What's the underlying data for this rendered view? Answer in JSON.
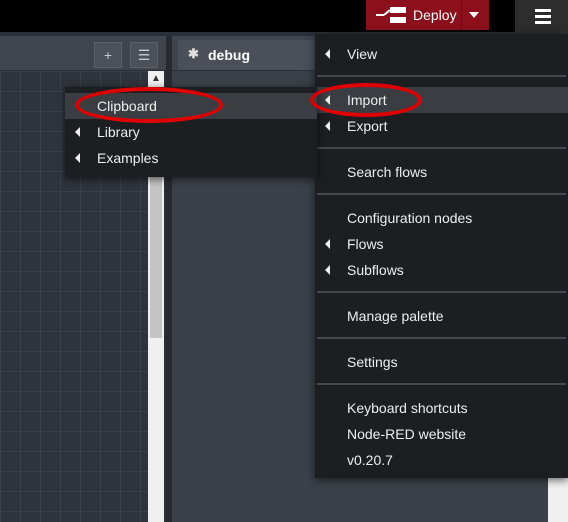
{
  "topbar": {
    "deploy_label": "Deploy"
  },
  "workspace": {
    "add_button": "+",
    "list_button": "☰"
  },
  "sidebar": {
    "debug_tab_label": "debug",
    "debug_icon": "✱"
  },
  "main_menu": {
    "items": [
      {
        "label": "View"
      },
      {
        "label": "Import"
      },
      {
        "label": "Export"
      },
      {
        "label": "Search flows"
      },
      {
        "label": "Configuration nodes"
      },
      {
        "label": "Flows"
      },
      {
        "label": "Subflows"
      },
      {
        "label": "Manage palette"
      },
      {
        "label": "Settings"
      },
      {
        "label": "Keyboard shortcuts"
      },
      {
        "label": "Node-RED website"
      },
      {
        "label": "v0.20.7"
      }
    ]
  },
  "import_submenu": {
    "items": [
      {
        "label": "Clipboard"
      },
      {
        "label": "Library"
      },
      {
        "label": "Examples"
      }
    ]
  },
  "colors": {
    "deploy_bg": "#8c101c",
    "menu_bg": "#1d1e22",
    "highlight_ring": "#e00000"
  }
}
